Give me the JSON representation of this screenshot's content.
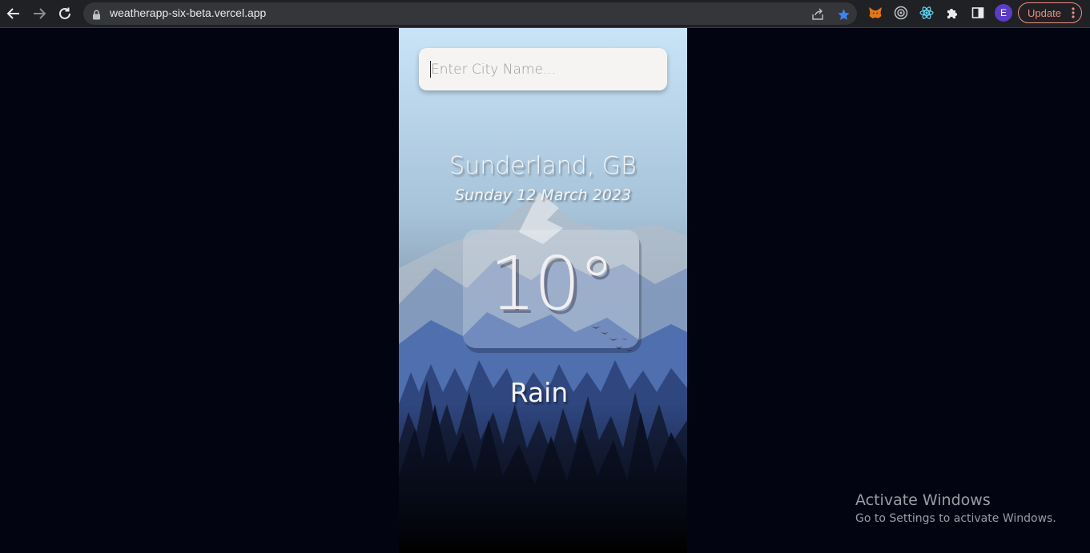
{
  "browser": {
    "url": "weatherapp-six-beta.vercel.app",
    "profile_initial": "E",
    "update_label": "Update",
    "icons": [
      "back-arrow-icon",
      "forward-arrow-icon",
      "reload-icon",
      "lock-icon",
      "share-icon",
      "bookmark-star-icon",
      "metamask-fox-icon",
      "target-extension-icon",
      "react-devtools-icon",
      "puzzle-extensions-icon",
      "side-panel-icon",
      "kebab-menu-icon"
    ]
  },
  "app": {
    "search_placeholder": "Enter City Name...",
    "location": "Sunderland, GB",
    "date": "Sunday 12 March 2023",
    "temperature": "10°",
    "condition": "Rain"
  },
  "watermark": {
    "title": "Activate Windows",
    "subtitle": "Go to Settings to activate Windows."
  },
  "colors": {
    "page_background": "#030412",
    "chrome_background": "#202124",
    "omnibox_background": "#35363a",
    "accent_star": "#3b82f6",
    "update_accent": "#f28b82",
    "sky_top": "#c9e3f7",
    "mountain_blue": "#3f63a8",
    "forest_dark": "#0a0f20"
  }
}
